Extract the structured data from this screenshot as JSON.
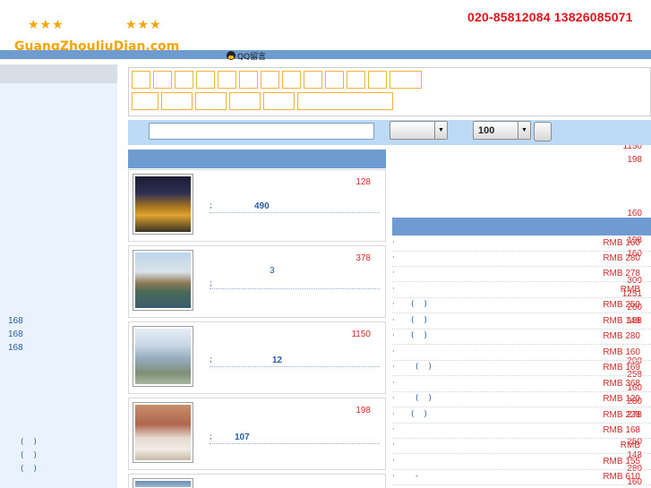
{
  "header": {
    "stars_left": "★★★",
    "stars_right": "★★★",
    "site_name": "GuangZhouJiuDian.com",
    "phones": "020-85812084  13826085071",
    "qq_label": "QQ留言"
  },
  "sidebar": {
    "prices": [
      "128",
      "378",
      "1150",
      "198",
      "160",
      "168",
      "198",
      "160",
      "300",
      "1251",
      "260",
      "188",
      "200",
      "258",
      "160",
      "280",
      "278",
      "250",
      "148",
      "280",
      "160"
    ],
    "left_values": [
      "168",
      "168",
      "168"
    ],
    "parens": [
      "( )",
      "( )",
      "( )"
    ]
  },
  "search": {
    "select_1_value": "",
    "select_2_value": "100"
  },
  "hotels": [
    {
      "price": "128",
      "count": "490",
      "extra": ""
    },
    {
      "price": "378",
      "count": "",
      "extra": "3"
    },
    {
      "price": "1150",
      "count": "12",
      "extra": ""
    },
    {
      "price": "198",
      "count": "107",
      "extra": ""
    }
  ],
  "right_list": [
    {
      "paren": "",
      "price": "RMB 160"
    },
    {
      "paren": "",
      "price": "RMB 280"
    },
    {
      "paren": "",
      "price": "RMB 278"
    },
    {
      "paren": "",
      "price": "RMB"
    },
    {
      "paren": "( )",
      "price": "RMB 250"
    },
    {
      "paren": "( )",
      "price": "RMB 148"
    },
    {
      "paren": "( )",
      "price": "RMB 280"
    },
    {
      "paren": "",
      "price": "RMB 160"
    },
    {
      "paren": "( )",
      "price": "RMB 169"
    },
    {
      "paren": "",
      "price": "RMB 368"
    },
    {
      "paren": "( )",
      "price": "RMB 120"
    },
    {
      "paren": "( )",
      "price": "RMB 228"
    },
    {
      "paren": "",
      "price": "RMB 168"
    },
    {
      "paren": "",
      "price": "RMB"
    },
    {
      "paren": "",
      "price": "RMB 155"
    },
    {
      "paren": "-",
      "price": "RMB 610"
    }
  ],
  "colors": {
    "accent_blue": "#6e9bd0",
    "price_red": "#d42a2a",
    "star_orange": "#f6a400",
    "filter_border": "#f3b13a"
  }
}
